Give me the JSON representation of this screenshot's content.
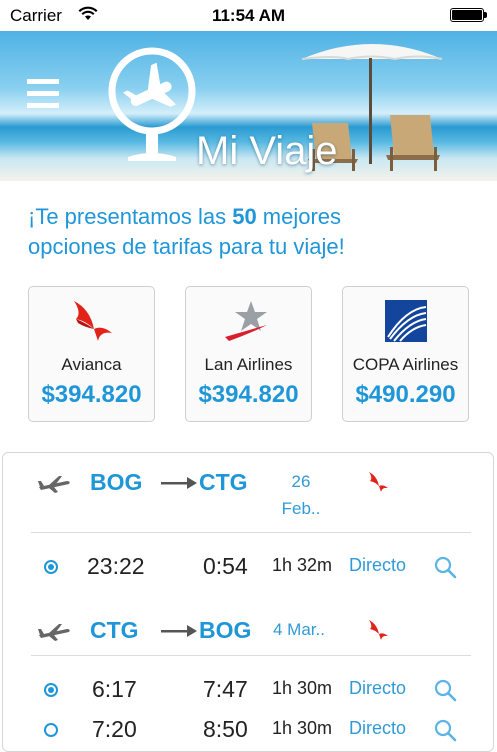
{
  "status_bar": {
    "carrier": "Carrier",
    "time": "11:54 AM"
  },
  "header": {
    "title": "Mi Viaje"
  },
  "intro": {
    "line1_prefix": "¡Te presentamos las ",
    "count": "50",
    "line1_suffix": " mejores",
    "line2": "opciones de tarifas para tu viaje!"
  },
  "airlines": [
    {
      "name": "Avianca",
      "price": "$394.820",
      "icon": "avianca-logo",
      "color": "#e2231a"
    },
    {
      "name": "Lan Airlines",
      "price": "$394.820",
      "icon": "lan-logo",
      "color": "#d71f2e"
    },
    {
      "name": "COPA Airlines",
      "price": "$490.290",
      "icon": "copa-logo",
      "color": "#12459b"
    }
  ],
  "outbound": {
    "from": "BOG",
    "to": "CTG",
    "date_line1": "26",
    "date_line2": "Feb..",
    "options": [
      {
        "departure": "23:22",
        "arrival": "0:54",
        "duration": "1h 32m",
        "type": "Directo",
        "selected": true
      }
    ]
  },
  "return": {
    "from": "CTG",
    "to": "BOG",
    "date": "4 Mar..",
    "options": [
      {
        "departure": "6:17",
        "arrival": "7:47",
        "duration": "1h 30m",
        "type": "Directo",
        "selected": true
      },
      {
        "departure": "7:20",
        "arrival": "8:50",
        "duration": "1h 30m",
        "type": "Directo",
        "selected": false
      }
    ]
  },
  "colors": {
    "accent": "#1f96d8",
    "text": "#222222",
    "avianca_red": "#e2231a"
  }
}
